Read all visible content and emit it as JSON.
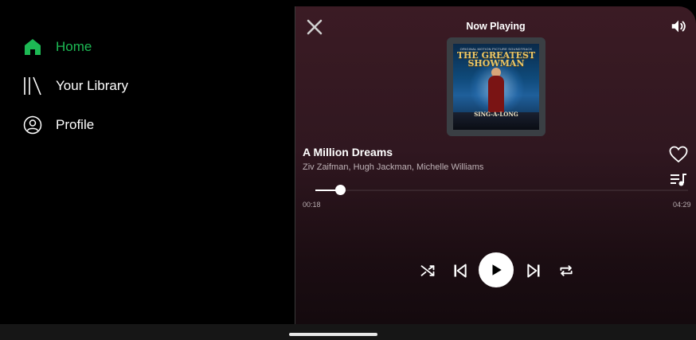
{
  "sidebar": {
    "items": [
      {
        "label": "Home",
        "icon": "home-icon",
        "active": true
      },
      {
        "label": "Your Library",
        "icon": "library-icon",
        "active": false
      },
      {
        "label": "Profile",
        "icon": "profile-icon",
        "active": false
      }
    ]
  },
  "player": {
    "header_title": "Now Playing",
    "album_art": {
      "top_caption": "ORIGINAL MOTION PICTURE SOUNDTRACK",
      "title_line1": "THE GREATEST",
      "title_line2": "SHOWMAN",
      "subtitle": "SING-A-LONG"
    },
    "track": {
      "title": "A Million Dreams",
      "artists": "Ziv Zaifman, Hugh Jackman, Michelle Williams"
    },
    "progress": {
      "elapsed": "00:18",
      "total": "04:29",
      "fraction": 0.067
    },
    "icons": {
      "close": "close-icon",
      "volume": "volume-icon",
      "like": "heart-icon",
      "queue": "queue-icon",
      "shuffle": "shuffle-icon",
      "previous": "skip-previous-icon",
      "play": "play-icon",
      "next": "skip-next-icon",
      "repeat": "repeat-icon"
    }
  },
  "colors": {
    "accent": "#1db954",
    "background": "#000000",
    "player_top": "#3b1b24",
    "player_bottom": "#140a0e"
  }
}
